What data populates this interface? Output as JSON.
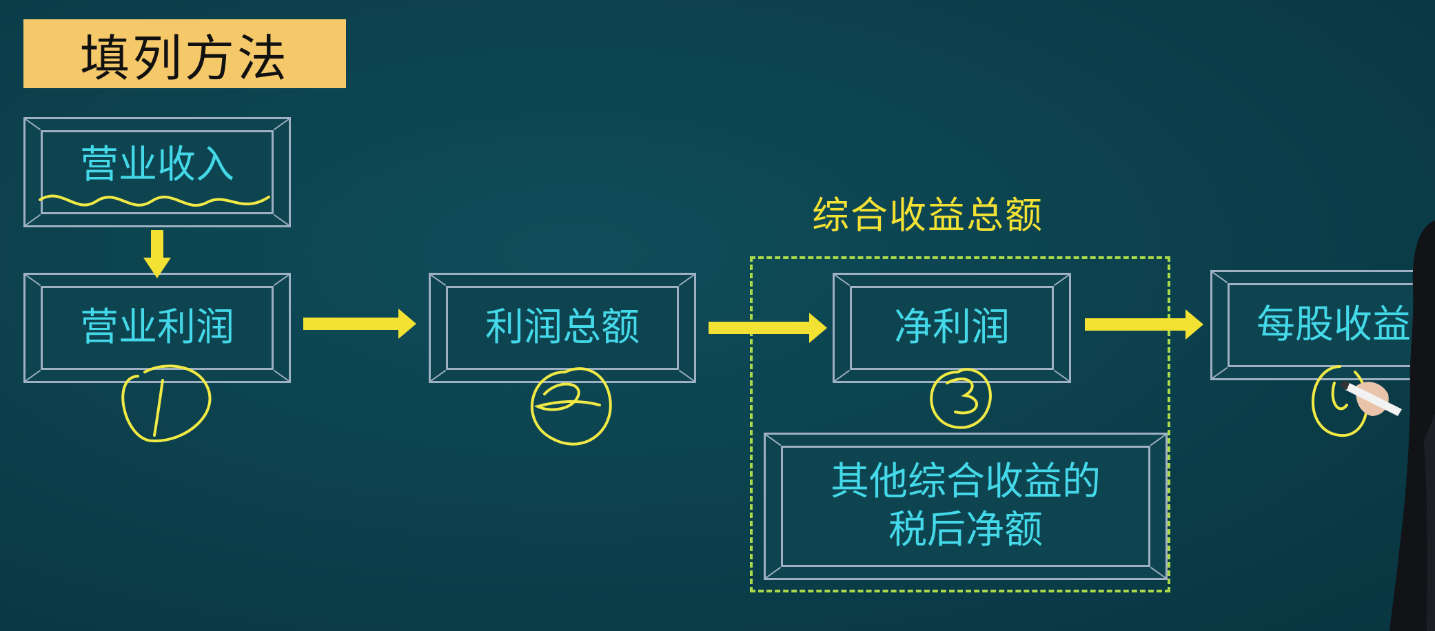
{
  "title": "填列方法",
  "group_caption": "综合收益总额",
  "boxes": {
    "revenue": "营业收入",
    "operating_profit": "营业利润",
    "total_profit": "利润总额",
    "net_profit": "净利润",
    "eps": "每股收益",
    "oci_line1": "其他综合收益的",
    "oci_line2": "税后净额"
  },
  "colors": {
    "background": "#0b3f4b",
    "title_bg": "#f5c96a",
    "box_text": "#44d8e8",
    "arrow": "#f3e234",
    "handwriting": "#f1ea45",
    "dashed_border": "#a9d94b"
  },
  "icons": [
    "arrow-right-icon",
    "arrow-down-icon",
    "pen-icon"
  ]
}
